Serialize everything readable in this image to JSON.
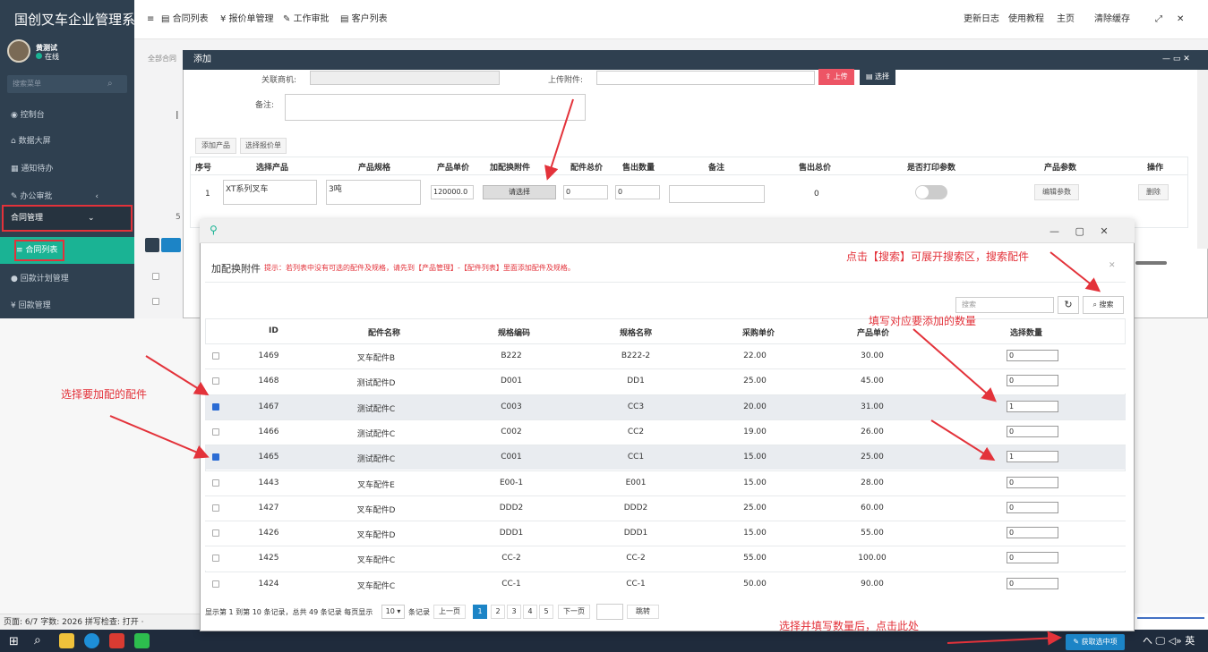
{
  "app": {
    "brand": "国创叉车企业管理系"
  },
  "top_tabs": [
    "≡",
    "合同列表",
    "报价单管理",
    "工作审批",
    "客户列表"
  ],
  "top_right": [
    "更新日志",
    "使用教程",
    "主页",
    "清除缓存"
  ],
  "sidebar": {
    "user_name": "黄测试",
    "user_status": "在线",
    "search_placeholder": "搜索菜单",
    "items": [
      "控制台",
      "数据大屏",
      "通知待办",
      "办公审批",
      "合同管理",
      "合同列表",
      "回款计划管理",
      "回款管理"
    ]
  },
  "behind": {
    "tab": "全部合同",
    "glyph_a": "I",
    "glyph_b": "5"
  },
  "add_dialog": {
    "title": "添加",
    "related_label": "关联商机:",
    "upload_label": "上传附件:",
    "upload_btn": "上传",
    "choose_btn": "选择",
    "remark_label": "备注:",
    "add_product_btn": "添加产品",
    "choose_quote_btn": "选择报价单",
    "headers": [
      "序号",
      "选择产品",
      "产品规格",
      "产品单价",
      "加配换附件",
      "配件总价",
      "售出数量",
      "备注",
      "售出总价",
      "是否打印参数",
      "产品参数",
      "操作"
    ],
    "row": {
      "seq": "1",
      "product": "XT系列叉车",
      "spec": "3吨",
      "price": "120000.0",
      "choose_btn": "请选择",
      "acc_total": "0",
      "qty": "0",
      "total": "0",
      "param_btn": "编辑参数",
      "delete_btn": "删除"
    }
  },
  "acc_modal": {
    "pin": "⚲",
    "title": "加配换附件",
    "tip": "提示：若列表中没有可选的配件及规格，请先到【产品管理】-【配件列表】里面添加配件及规格。",
    "search_placeholder": "搜索",
    "search_btn": "搜索",
    "columns": [
      "ID",
      "配件名称",
      "规格编码",
      "规格名称",
      "采购单价",
      "产品单价",
      "选择数量"
    ],
    "rows": [
      {
        "id": "1469",
        "name": "叉车配件B",
        "code": "B222",
        "spec": "B222-2",
        "cost": "22.00",
        "price": "30.00",
        "qty": "0",
        "checked": false
      },
      {
        "id": "1468",
        "name": "测试配件D",
        "code": "D001",
        "spec": "DD1",
        "cost": "25.00",
        "price": "45.00",
        "qty": "0",
        "checked": false
      },
      {
        "id": "1467",
        "name": "测试配件C",
        "code": "C003",
        "spec": "CC3",
        "cost": "20.00",
        "price": "31.00",
        "qty": "1",
        "checked": true
      },
      {
        "id": "1466",
        "name": "测试配件C",
        "code": "C002",
        "spec": "CC2",
        "cost": "19.00",
        "price": "26.00",
        "qty": "0",
        "checked": false
      },
      {
        "id": "1465",
        "name": "测试配件C",
        "code": "C001",
        "spec": "CC1",
        "cost": "15.00",
        "price": "25.00",
        "qty": "1",
        "checked": true
      },
      {
        "id": "1443",
        "name": "叉车配件E",
        "code": "E00-1",
        "spec": "E001",
        "cost": "15.00",
        "price": "28.00",
        "qty": "0",
        "checked": false
      },
      {
        "id": "1427",
        "name": "叉车配件D",
        "code": "DDD2",
        "spec": "DDD2",
        "cost": "25.00",
        "price": "60.00",
        "qty": "0",
        "checked": false
      },
      {
        "id": "1426",
        "name": "叉车配件D",
        "code": "DDD1",
        "spec": "DDD1",
        "cost": "15.00",
        "price": "55.00",
        "qty": "0",
        "checked": false
      },
      {
        "id": "1425",
        "name": "叉车配件C",
        "code": "CC-2",
        "spec": "CC-2",
        "cost": "55.00",
        "price": "100.00",
        "qty": "0",
        "checked": false
      },
      {
        "id": "1424",
        "name": "叉车配件C",
        "code": "CC-1",
        "spec": "CC-1",
        "cost": "50.00",
        "price": "90.00",
        "qty": "0",
        "checked": false
      }
    ],
    "pagination": {
      "info_a": "显示第 1 到第 10 条记录，总共 49 条记录 每页显示",
      "per_page": "10",
      "info_b": "条记录",
      "prev": "上一页",
      "pages": [
        "1",
        "2",
        "3",
        "4",
        "5"
      ],
      "next": "下一页",
      "jump": "跳转"
    },
    "submit_btn": "获取选中项"
  },
  "annotations": {
    "search": "点击【搜索】可展开搜索区，搜索配件",
    "fill_qty": "填写对应要添加的数量",
    "select_acc": "选择要加配的配件",
    "submit": "选择并填写数量后，点击此处"
  },
  "doc_status": "页面: 6/7   字数: 2026   拼写检查: 打开 ·",
  "taskbar_right": "へ 🖵 ◁» 英",
  "colors": {
    "sidebar": "#2f4050",
    "accent": "#1ab394",
    "annotation": "#e3323a",
    "primary": "#1c84c6"
  }
}
